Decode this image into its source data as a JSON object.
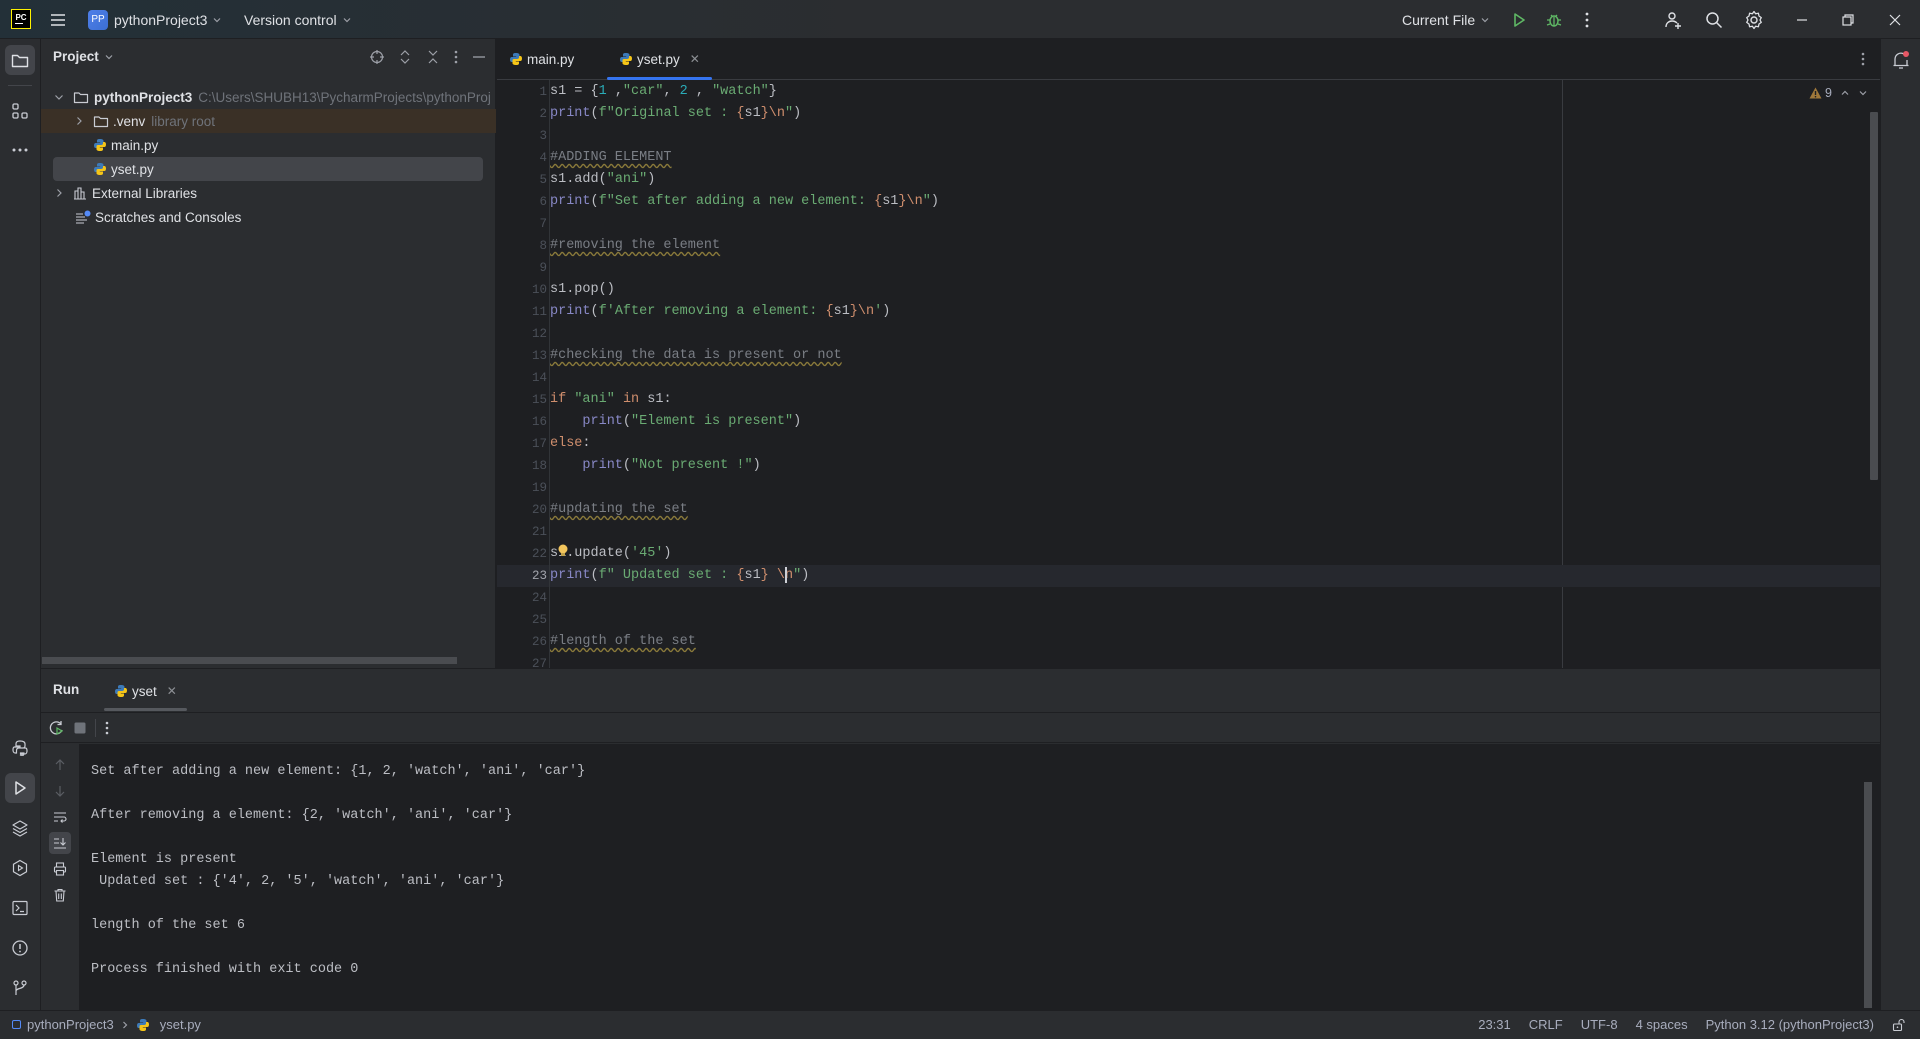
{
  "titlebar": {
    "project_badge": "PP",
    "project_name": "pythonProject3",
    "vcs_label": "Version control",
    "run_config": "Current File"
  },
  "project_panel": {
    "title": "Project",
    "tree": [
      {
        "label": "pythonProject3",
        "hint": "C:\\Users\\SHUBH13\\PycharmProjects\\pythonProj",
        "type": "folder",
        "expanded": true
      },
      {
        "label": ".venv",
        "hint": "library root",
        "type": "folder",
        "expanded": false
      },
      {
        "label": "main.py",
        "type": "python-file"
      },
      {
        "label": "yset.py",
        "type": "python-file",
        "selected": true
      },
      {
        "label": "External Libraries",
        "type": "libraries",
        "expanded": false
      },
      {
        "label": "Scratches and Consoles",
        "type": "scratches"
      }
    ]
  },
  "editor": {
    "tabs": [
      {
        "label": "main.py",
        "active": false
      },
      {
        "label": "yset.py",
        "active": true
      }
    ],
    "warnings_count": "9",
    "current_line": 23,
    "lines": [
      "s1 = {1 ,\"car\", 2 , \"watch\"}",
      "print(f\"Original set : {s1}\\n\")",
      "",
      "#ADDING ELEMENT",
      "s1.add(\"ani\")",
      "print(f\"Set after adding a new element: {s1}\\n\")",
      "",
      "#removing the element",
      "",
      "s1.pop()",
      "print(f'After removing a element: {s1}\\n')",
      "",
      "#checking the data is present or not",
      "",
      "if \"ani\" in s1:",
      "    print(\"Element is present\")",
      "else:",
      "    print(\"Not present !\")",
      "",
      "#updating the set",
      "",
      "s1.update('45')",
      "print(f\" Updated set : {s1} \\n\")",
      "",
      "",
      "#length of the set",
      ""
    ]
  },
  "run_panel": {
    "title": "Run",
    "tab_label": "yset",
    "output": [
      "Set after adding a new element: {1, 2, 'watch', 'ani', 'car'}",
      "",
      "After removing a element: {2, 'watch', 'ani', 'car'}",
      "",
      "Element is present",
      " Updated set : {'4', 2, '5', 'watch', 'ani', 'car'}",
      "",
      "length of the set 6",
      "",
      "Process finished with exit code 0"
    ]
  },
  "statusbar": {
    "breadcrumb": [
      "pythonProject3",
      "yset.py"
    ],
    "caret_position": "23:31",
    "line_separator": "CRLF",
    "encoding": "UTF-8",
    "indent": "4 spaces",
    "interpreter": "Python 3.12 (pythonProject3)"
  },
  "colors": {
    "accent": "#3574f0",
    "keyword": "#cf8e6d",
    "string": "#6aab73",
    "number": "#2aacb8",
    "builtin": "#8888c6",
    "comment": "#7a7e85",
    "run_green": "#5fb865",
    "notification_badge": "#e55765"
  }
}
